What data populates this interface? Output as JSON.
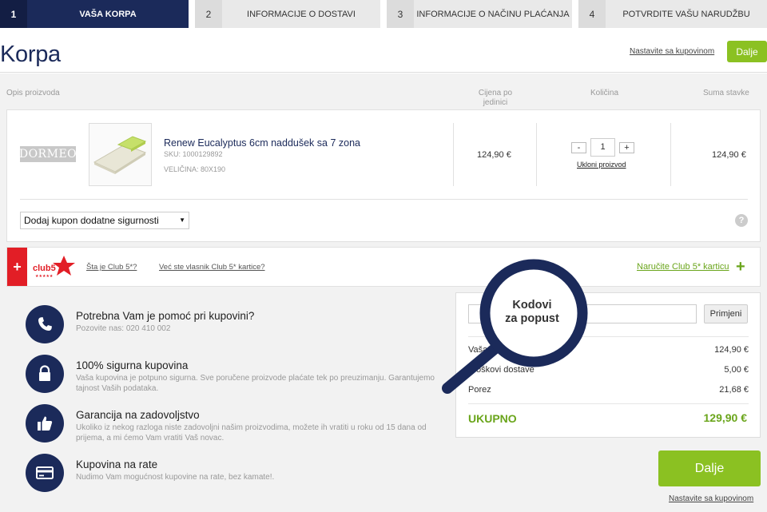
{
  "steps": [
    {
      "num": "1",
      "label": "Vaša korpa"
    },
    {
      "num": "2",
      "label": "Informacije o dostavi"
    },
    {
      "num": "3",
      "label": "Informacije o načinu plaćanja"
    },
    {
      "num": "4",
      "label": "Potvrdite vašu narudžbu"
    }
  ],
  "page": {
    "title": "Korpa",
    "continue_shopping": "Nastavite sa kupovinom",
    "next_button": "Dalje"
  },
  "columns": {
    "description": "Opis proizvoda",
    "unit_price": "Cijena po jedinici",
    "quantity": "Količina",
    "line_total": "Suma stavke"
  },
  "item": {
    "brand": "DORMEO",
    "name": "Renew Eucalyptus 6cm naddušek sa 7 zona",
    "sku": "SKU: 1000129892",
    "size": "VELIČINA: 80X190",
    "unit_price": "124,90 €",
    "qty_minus": "-",
    "quantity": "1",
    "qty_plus": "+",
    "remove": "Ukloni proizvod",
    "line_total": "124,90 €"
  },
  "coupon": {
    "select_label": "Dodaj kupon dodatne sigurnosti",
    "help": "?"
  },
  "club": {
    "plus": "+",
    "logo_text": "club5",
    "what_is": "Šta je Club 5*?",
    "already_owner": "Već ste vlasnik Club 5* kartice?",
    "order_card": "Naručite Club 5* karticu",
    "order_plus": "+"
  },
  "info": [
    {
      "icon": "phone-icon",
      "title": "Potrebna Vam je pomoć pri kupovini?",
      "text": "Pozovite nas: 020 410 002"
    },
    {
      "icon": "lock-icon",
      "title": "100% sigurna kupovina",
      "text": "Vaša kupovina je potpuno sigurna. Sve poručene proizvode plaćate tek po preuzimanju. Garantujemo tajnost Vaših podataka."
    },
    {
      "icon": "thumbs-up-icon",
      "title": "Garancija na zadovoljstvo",
      "text": "Ukoliko iz nekog razloga niste zadovoljni našim proizvodima, možete ih vratiti u roku od 15 dana od prijema, a mi ćemo Vam vratiti Vaš novac."
    },
    {
      "icon": "credit-card-icon",
      "title": "Kupovina na rate",
      "text": "Nudimo Vam mogućnost kupovine na rate, bez kamate!."
    }
  ],
  "summary": {
    "apply": "Primjeni",
    "rows": [
      {
        "label": "Vaša",
        "value": "124,90 €"
      },
      {
        "label": "Troškovi dostave",
        "value": "5,00 €"
      },
      {
        "label": "Porez",
        "value": "21,68 €"
      }
    ],
    "total_label": "UKUPNO",
    "total_value": "129,90 €"
  },
  "magnifier": {
    "line1": "Kodovi",
    "line2": "za popust"
  },
  "colors": {
    "navy": "#1b2a5a",
    "green": "#8bc122",
    "red": "#e21e26"
  }
}
